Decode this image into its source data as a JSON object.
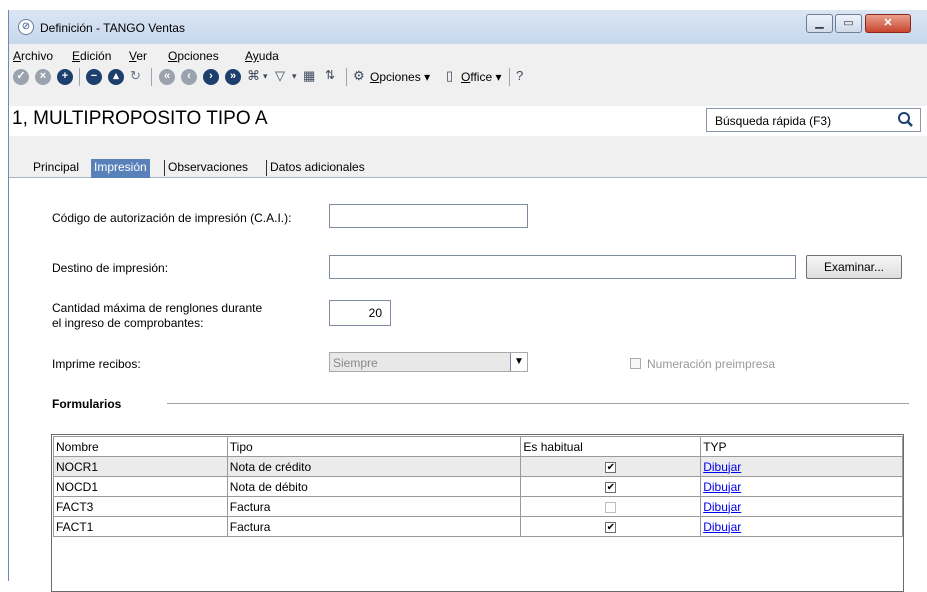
{
  "window": {
    "title": "Definición - TANGO Ventas",
    "buttons": [
      "minimize",
      "maximize",
      "close"
    ]
  },
  "menu": {
    "items": [
      {
        "first": "A",
        "rest": "rchivo"
      },
      {
        "first": "E",
        "rest": "dición"
      },
      {
        "first": "V",
        "rest": "er"
      },
      {
        "first": "O",
        "rest": "pciones"
      },
      {
        "first": "Ay",
        "rest": "uda"
      }
    ]
  },
  "toolbar": {
    "options_first": "O",
    "options_rest": "pciones",
    "office_first": "O",
    "office_rest": "ffice",
    "dropdown_glyph": "▾"
  },
  "record": {
    "title": "1, MULTIPROPOSITO TIPO A"
  },
  "search": {
    "placeholder": "Búsqueda rápida (F3)"
  },
  "tabs": [
    {
      "label": "Principal",
      "active": false
    },
    {
      "label": "Impresión",
      "active": true
    },
    {
      "label": "Observaciones",
      "active": false
    },
    {
      "label": "Datos adicionales",
      "active": false
    }
  ],
  "form": {
    "cai_label": "Código de autorización de impresión (C.A.I.):",
    "cai_value": "",
    "destino_label": "Destino de impresión:",
    "destino_value": "",
    "examinar_label": "Examinar...",
    "cantidad_label_1": "Cantidad máxima de renglones durante",
    "cantidad_label_2": "el ingreso de comprobantes:",
    "cantidad_value": "20",
    "recibos_label": "Imprime recibos:",
    "recibos_value": "Siempre",
    "numeracion_label": "Numeración preimpresa",
    "numeracion_checked": false
  },
  "formularios": {
    "title": "Formularios",
    "columns": [
      "Nombre",
      "Tipo",
      "Es habitual",
      "TYP"
    ],
    "rows": [
      {
        "nombre": "NOCR1",
        "tipo": "Nota de crédito",
        "habitual": true,
        "typ": "Dibujar"
      },
      {
        "nombre": "NOCD1",
        "tipo": "Nota de débito",
        "habitual": true,
        "typ": "Dibujar"
      },
      {
        "nombre": "FACT3",
        "tipo": "Factura",
        "habitual": false,
        "typ": "Dibujar"
      },
      {
        "nombre": "FACT1",
        "tipo": "Factura",
        "habitual": true,
        "typ": "Dibujar"
      }
    ]
  },
  "colors": {
    "active_tab": "#5880b9",
    "link": "#0000ee",
    "titlebar": "#c6d7ec",
    "close_button": "#c7452e"
  }
}
